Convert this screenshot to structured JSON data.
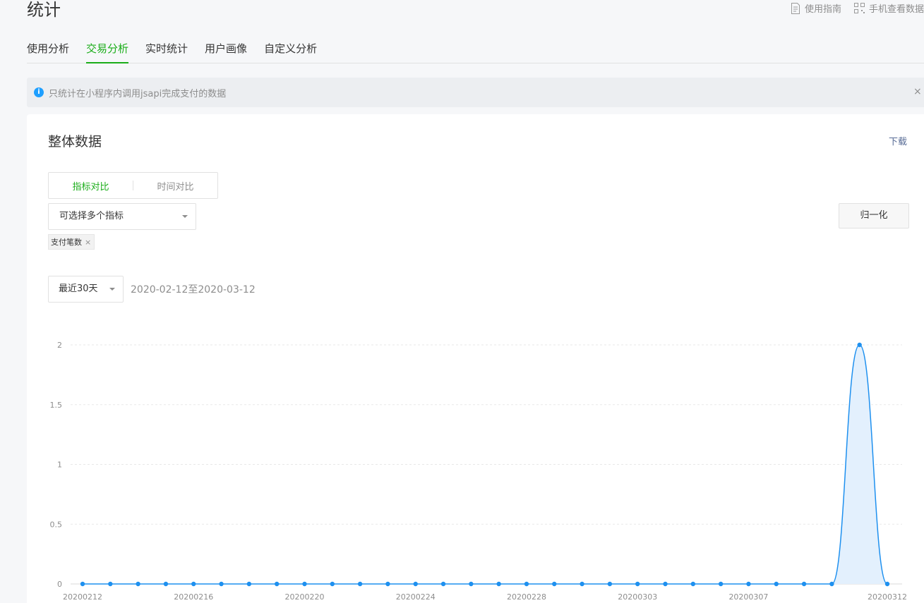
{
  "page": {
    "title": "统计"
  },
  "top_links": [
    {
      "label": "使用指南",
      "icon": "document-icon"
    },
    {
      "label": "手机查看数据",
      "icon": "qrcode-icon"
    }
  ],
  "tabs": [
    {
      "label": "使用分析",
      "active": false
    },
    {
      "label": "交易分析",
      "active": true
    },
    {
      "label": "实时统计",
      "active": false
    },
    {
      "label": "用户画像",
      "active": false
    },
    {
      "label": "自定义分析",
      "active": false
    }
  ],
  "notice": {
    "text": "只统计在小程序内调用jsapi完成支付的数据",
    "close": "×"
  },
  "card": {
    "title": "整体数据",
    "download": "下载",
    "segments": [
      "指标对比",
      "时间对比"
    ],
    "metric_select_placeholder": "可选择多个指标",
    "normalize_label": "归一化",
    "tag_label": "支付笔数",
    "tag_close": "×",
    "range_select": "最近30天",
    "range_text": "2020-02-12至2020-03-12"
  },
  "colors": {
    "accent": "#1aad19",
    "line": "#1e90ef",
    "area": "#e3f0fd",
    "link": "#576b95"
  },
  "chart_data": {
    "type": "area",
    "title": "",
    "xlabel": "",
    "ylabel": "",
    "ylim": [
      0,
      2
    ],
    "yticks": [
      "0",
      "0.5",
      "1",
      "1.5",
      "2"
    ],
    "x": [
      "20200212",
      "20200213",
      "20200214",
      "20200215",
      "20200216",
      "20200217",
      "20200218",
      "20200219",
      "20200220",
      "20200221",
      "20200222",
      "20200223",
      "20200224",
      "20200225",
      "20200226",
      "20200227",
      "20200228",
      "20200229",
      "20200301",
      "20200302",
      "20200303",
      "20200304",
      "20200305",
      "20200306",
      "20200307",
      "20200308",
      "20200309",
      "20200310",
      "20200311",
      "20200312"
    ],
    "xtick_labels": [
      "20200212",
      "20200216",
      "20200220",
      "20200224",
      "20200228",
      "20200303",
      "20200307",
      "20200312"
    ],
    "series": [
      {
        "values": [
          0,
          0,
          0,
          0,
          0,
          0,
          0,
          0,
          0,
          0,
          0,
          0,
          0,
          0,
          0,
          0,
          0,
          0,
          0,
          0,
          0,
          0,
          0,
          0,
          0,
          0,
          0,
          0,
          2,
          0
        ]
      }
    ],
    "grid": true
  }
}
